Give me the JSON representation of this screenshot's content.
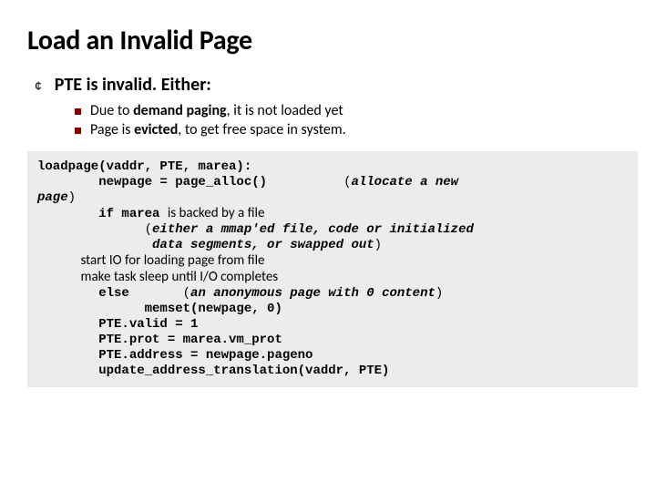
{
  "title": "Load an Invalid Page",
  "lvl1": "PTE is invalid. Either:",
  "lvl2a_pre": "Due to ",
  "lvl2a_b": "demand paging",
  "lvl2a_post": ", it is not loaded yet",
  "lvl2b_pre": "Page is ",
  "lvl2b_b": "evicted",
  "lvl2b_post": ", to get free space in system.",
  "c1": "loadpage(vaddr, PTE, marea):",
  "c2": "        newpage = page_alloc()          ",
  "c2c_open": "(",
  "c2c": "allocate a new",
  "c3": "page",
  "c3_close": ")",
  "c4_pre": "        if marea ",
  "c4_plain": "is backed by a file",
  "c5_open": "              (",
  "c5c": "either a mmap'ed file, code or initialized",
  "c6c": "               data segments, or swapped out",
  "c6_close": ")",
  "c7_plain1": "              start IO for loading page from file",
  "c7_plain2": "              make task sleep until I/O completes",
  "c8_pre": "        else       ",
  "c8_open": "(",
  "c8c": "an anonymous page with 0 content",
  "c8_close": ")",
  "c9": "              memset(newpage, 0)",
  "c10": "        PTE.valid = 1",
  "c11": "        PTE.prot = marea.vm_prot",
  "c12": "        PTE.address = newpage.pageno",
  "c13": "        update_address_translation(vaddr, PTE)"
}
